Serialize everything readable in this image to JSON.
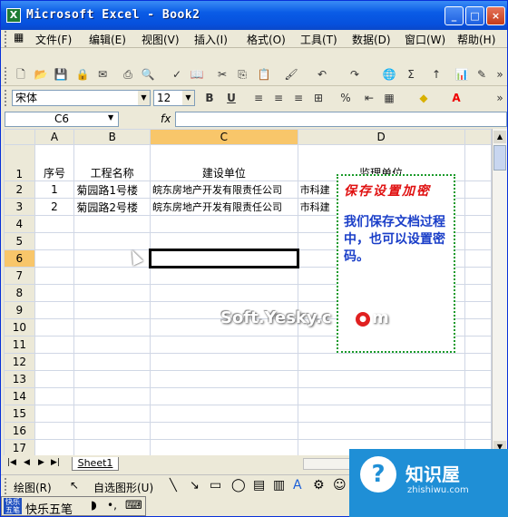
{
  "window": {
    "title": "Microsoft Excel - Book2",
    "buttons": {
      "minimize": "_",
      "maximize": "□",
      "close": "×"
    }
  },
  "menubar": {
    "items": [
      "文件(F)",
      "编辑(E)",
      "视图(V)",
      "插入(I)",
      "格式(O)",
      "工具(T)",
      "数据(D)",
      "窗口(W)",
      "帮助(H)"
    ]
  },
  "format_toolbar": {
    "font_name": "宋体",
    "font_size": "12",
    "bold": "B",
    "underline": "U",
    "percent": "%"
  },
  "formula_bar": {
    "name_box": "C6",
    "fx": "fx",
    "content": ""
  },
  "grid": {
    "columns": [
      "A",
      "B",
      "C",
      "D"
    ],
    "rows": [
      "1",
      "2",
      "3",
      "4",
      "5",
      "6",
      "7",
      "8",
      "9",
      "10",
      "11",
      "12",
      "13",
      "14",
      "15",
      "16",
      "17"
    ],
    "selected_cell": "C6",
    "header_row": [
      "序号",
      "工程名称",
      "建设单位",
      "监理单位"
    ],
    "data": [
      [
        "1",
        "菊园路1号楼",
        "皖东房地产开发有限责任公司",
        "市科建"
      ],
      [
        "2",
        "菊园路2号楼",
        "皖东房地产开发有限责任公司",
        "市科建"
      ]
    ]
  },
  "sheet_tabs": [
    "Sheet1"
  ],
  "drawing_toolbar": {
    "draw_label": "绘图(R)",
    "autoshape_label": "自选图形(U)"
  },
  "ime": {
    "name": "快乐五笔"
  },
  "note": {
    "title": "保存设置加密",
    "text": "我们保存文档过程中，也可以设置密码。"
  },
  "watermark": "Soft.Yesky.c",
  "brand": {
    "name": "知识屋",
    "url": "zhishiwu.com",
    "mark": "?"
  },
  "colors": {
    "title_bar": "#0a5ce6",
    "selection_header": "#f8c66a",
    "note_border": "#1a9a2a",
    "note_title": "#e01010",
    "note_text": "#1a3ec8",
    "brand": "#1f8fd6"
  }
}
